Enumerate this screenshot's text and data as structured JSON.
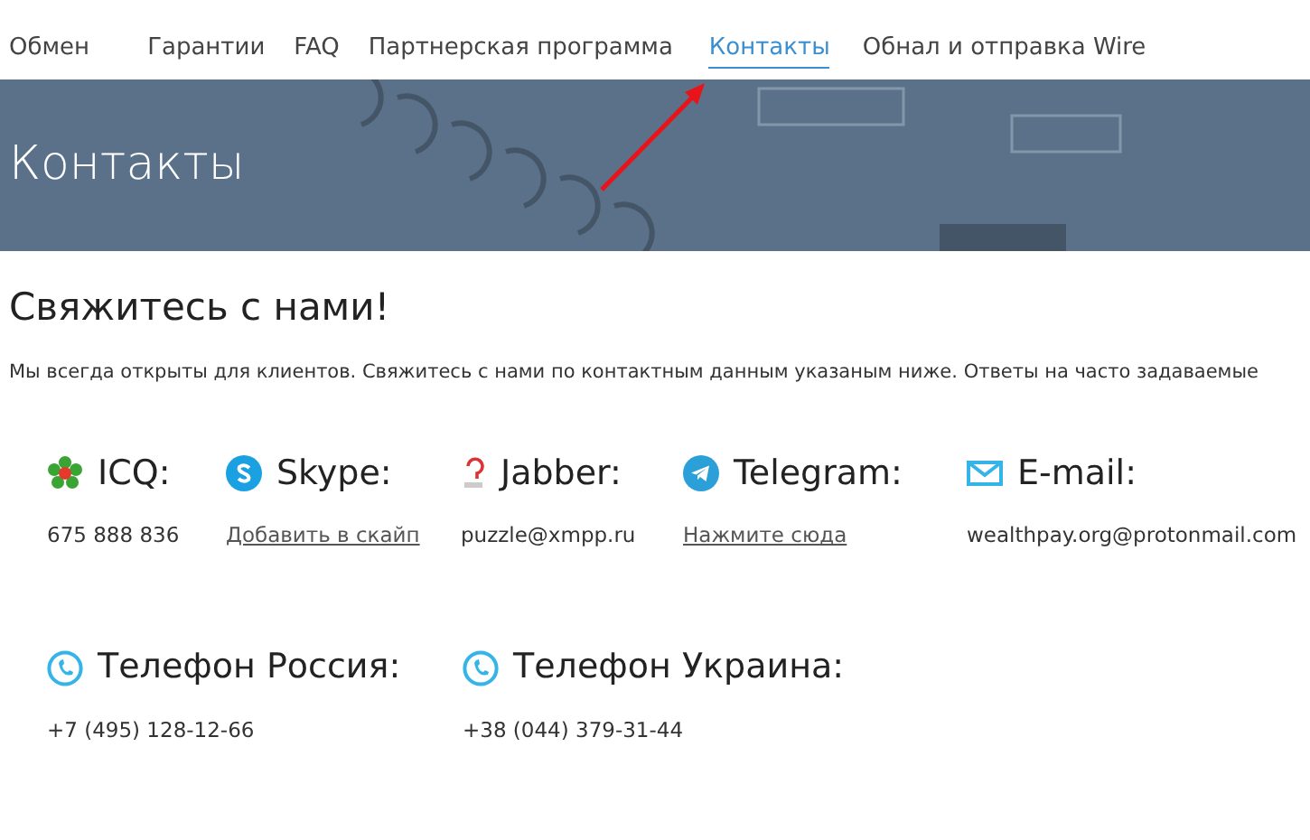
{
  "nav": [
    {
      "label": "Обмен",
      "selected": false
    },
    {
      "label": "Гарантии",
      "selected": false
    },
    {
      "label": "FAQ",
      "selected": false
    },
    {
      "label": "Партнерская программа",
      "selected": false
    },
    {
      "label": "Контакты",
      "selected": true
    },
    {
      "label": "Обнал и отправка Wire",
      "selected": false
    }
  ],
  "banner": {
    "title": "Контакты"
  },
  "heading": "Свяжитесь с нами!",
  "intro": "Мы всегда открыты для клиентов. Свяжитесь с нами по контактным данным указаным ниже. Ответы на часто задаваемые",
  "contact_rows": [
    [
      {
        "kind": "icq",
        "label": "ICQ:",
        "value": "675 888 836",
        "link": false
      },
      {
        "kind": "skype",
        "label": "Skype:",
        "value": "Добавить в скайп",
        "link": true
      },
      {
        "kind": "jabber",
        "label": "Jabber:",
        "value": "puzzle@xmpp.ru",
        "link": false
      },
      {
        "kind": "telegram",
        "label": "Telegram:",
        "value": "Нажмите сюда",
        "link": true
      },
      {
        "kind": "email",
        "label": "E-mail:",
        "value": "wealthpay.org@protonmail.com",
        "link": false
      }
    ],
    [
      {
        "kind": "phone",
        "label": "Телефон Россия:",
        "value": "+7 (495) 128-12-66",
        "link": false
      },
      {
        "kind": "phone",
        "label": "Телефон Украина:",
        "value": "+38 (044) 379-31-44",
        "link": false
      }
    ]
  ]
}
